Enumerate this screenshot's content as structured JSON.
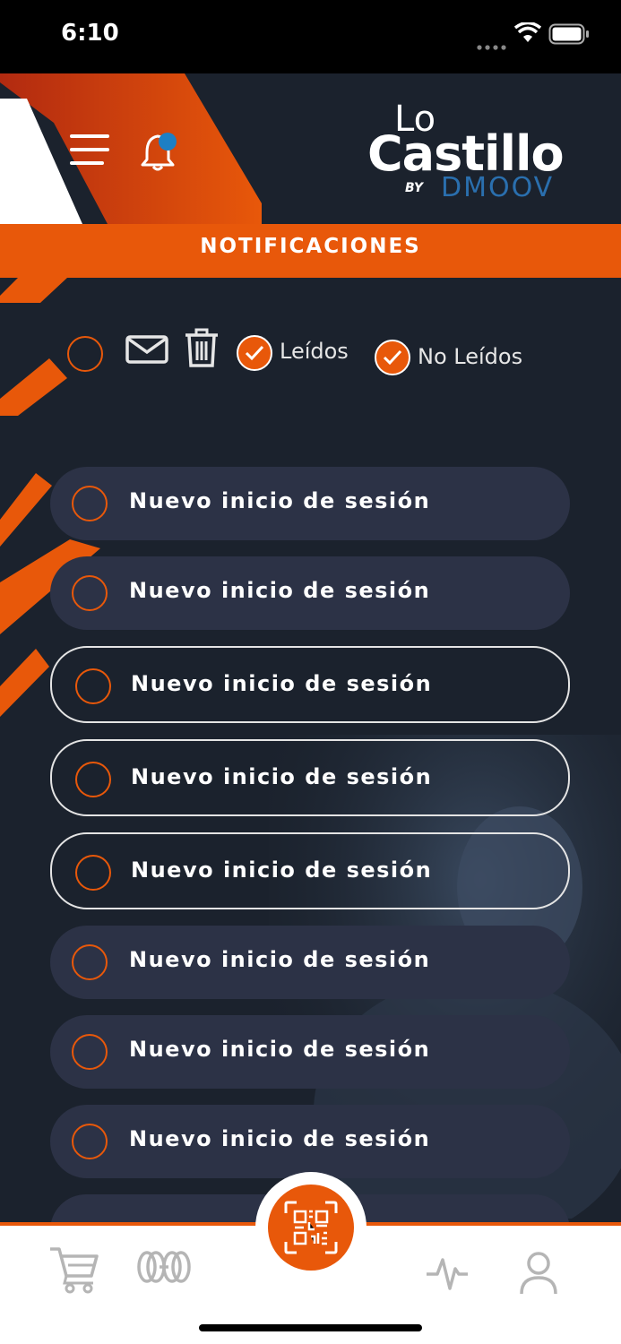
{
  "status_bar": {
    "time": "6:10"
  },
  "header": {
    "logo": {
      "line1": "Lo",
      "line2": "Castillo",
      "by": "BY",
      "brand": "DMOOV"
    },
    "title": "NOTIFICACIONES"
  },
  "toolbar": {
    "read_label": "Leídos",
    "unread_label": "No Leídos"
  },
  "notifications": [
    {
      "title": "Nuevo inicio de sesión",
      "state": "unread"
    },
    {
      "title": "Nuevo inicio de sesión",
      "state": "unread"
    },
    {
      "title": "Nuevo inicio de sesión",
      "state": "read"
    },
    {
      "title": "Nuevo inicio de sesión",
      "state": "read"
    },
    {
      "title": "Nuevo inicio de sesión",
      "state": "read"
    },
    {
      "title": "Nuevo inicio de sesión",
      "state": "unread"
    },
    {
      "title": "Nuevo inicio de sesión",
      "state": "unread"
    },
    {
      "title": "Nuevo inicio de sesión",
      "state": "unread"
    }
  ],
  "bottom_nav": {
    "items": [
      "cart-icon",
      "weights-icon",
      "qr-icon",
      "activity-icon",
      "user-icon"
    ]
  },
  "colors": {
    "accent": "#e8580a",
    "background": "#1b222d",
    "card": "#2c3246",
    "badge": "#1d7fc4"
  }
}
